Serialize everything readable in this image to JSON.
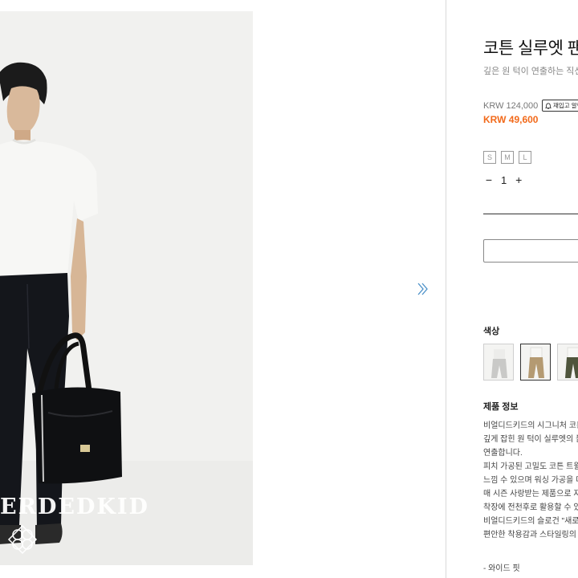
{
  "gallery": {
    "brand_watermark": "ERDEDKID",
    "next_icon": "double-chevron-right-icon"
  },
  "product": {
    "title": "코튼 실루엣 팬츠",
    "subtitle": "깊은 원 턱이 연출하는 직선적인 실루엣",
    "price_original": "KRW 124,000",
    "restock_label": "재입고 알림",
    "restock_icon": "bell-icon",
    "price_sale": "KRW 49,600",
    "sale_color": "#f26a1b",
    "sizes": [
      "S",
      "M",
      "L"
    ],
    "quantity": "1",
    "qty_minus": "−",
    "qty_plus": "+"
  },
  "colors": {
    "label": "색상",
    "swatches": [
      {
        "name": "light-grey",
        "pants": "#cfcfcf",
        "top": "#f4f4f2"
      },
      {
        "name": "beige",
        "pants": "#b49a72",
        "top": "#f4f4f2"
      },
      {
        "name": "khaki",
        "pants": "#4f553c",
        "top": "#f4f4f2"
      }
    ]
  },
  "description": {
    "label": "제품 정보",
    "lines": [
      "비얼디드키드의 시그니처 코튼 팬츠는",
      "깊게 잡힌 원 턱이 실루엣의 볼륨을",
      "연출합니다.",
      "피치 가공된 고밀도 코튼 트윌 소재로 부드러운",
      "느낌 수 있으며 워싱 가공을 더해",
      "매 시즌 사랑받는 제품으로 자리잡았습니다.",
      "착장에 전천후로 활용할 수 있는",
      "비얼디드키드의 슬로건 \"새로움\"처럼",
      "편안한 착용감과 스타일링의 즐거움을"
    ],
    "feature": "- 와이드 핏"
  }
}
